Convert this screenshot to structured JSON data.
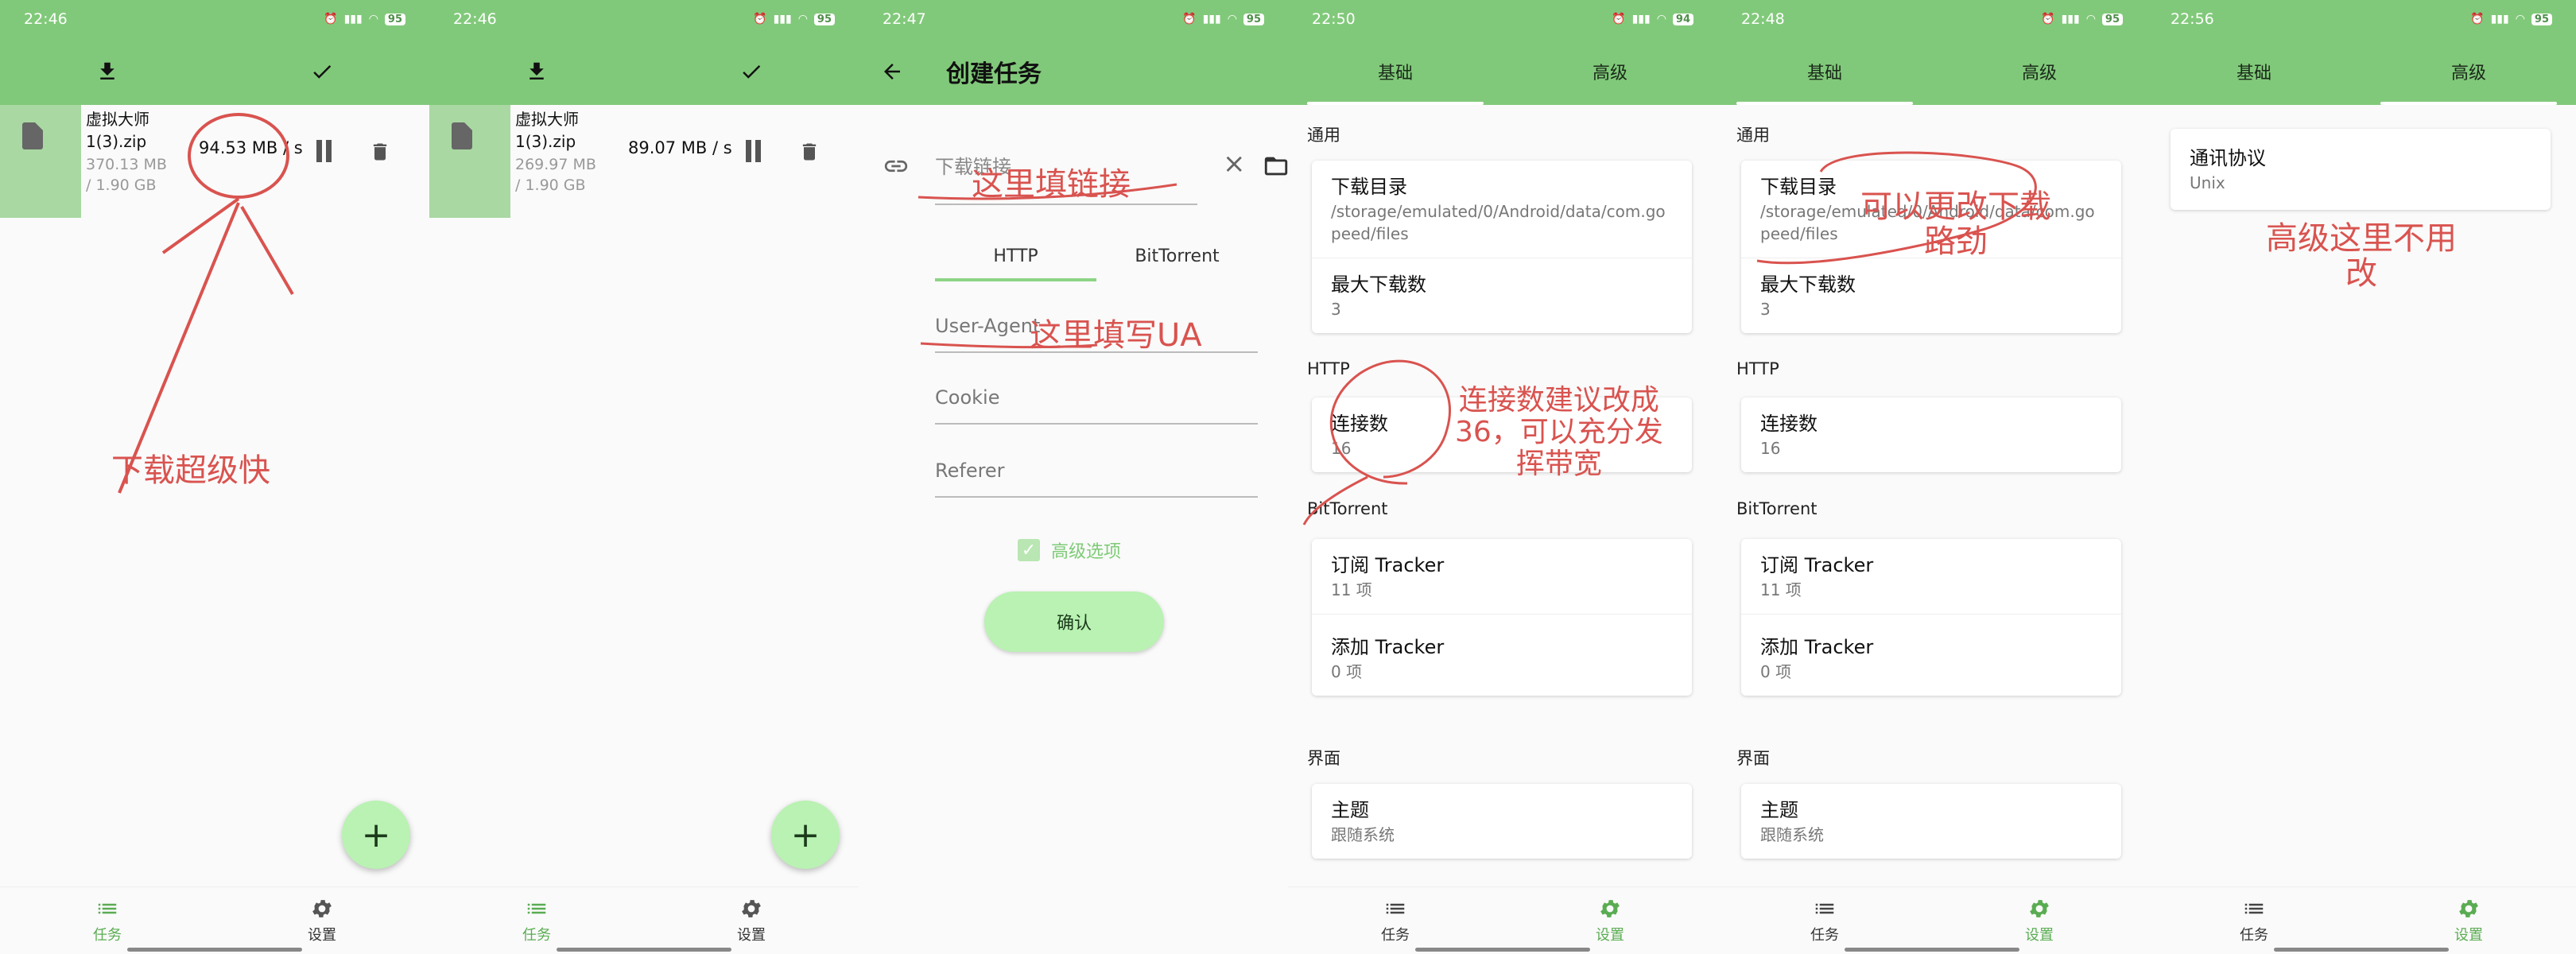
{
  "screens": [
    {
      "status": {
        "time": "22:46",
        "battery": "95"
      },
      "toolbar": {
        "download_icon": "download-icon",
        "check_icon": "check-icon"
      },
      "task": {
        "name": "虚拟大师1(3).zip",
        "size": "370.13 MB / 1.90 GB",
        "speed": "94.53 MB / s"
      },
      "annotation": "下载超级快",
      "nav": {
        "tasks": "任务",
        "settings": "设置"
      }
    },
    {
      "status": {
        "time": "22:46",
        "battery": "95"
      },
      "task": {
        "name": "虚拟大师1(3).zip",
        "size": "269.97 MB / 1.90 GB",
        "speed": "89.07 MB / s"
      },
      "nav": {
        "tasks": "任务",
        "settings": "设置"
      }
    },
    {
      "status": {
        "time": "22:47",
        "battery": "95"
      },
      "title": "创建任务",
      "link_placeholder": "下载链接",
      "tabs": [
        "HTTP",
        "BitTorrent"
      ],
      "fields": [
        "User-Agent",
        "Cookie",
        "Referer"
      ],
      "advanced": "高级选项",
      "confirm": "确认",
      "annotations": {
        "link": "这里填链接",
        "ua": "这里填写UA"
      }
    },
    {
      "status": {
        "time": "22:50",
        "battery": "94"
      },
      "tabs": [
        "基础",
        "高级"
      ],
      "sections": {
        "general": "通用",
        "http": "HTTP",
        "bt": "BitTorrent",
        "ui": "界面"
      },
      "download_dir": {
        "label": "下载目录",
        "value": "/storage/emulated/0/Android/data/com.gopeed/files"
      },
      "max_downloads": {
        "label": "最大下载数",
        "value": "3"
      },
      "connections": {
        "label": "连接数",
        "value": "16"
      },
      "sub_tracker": {
        "label": "订阅 Tracker",
        "value": "11 项"
      },
      "add_tracker": {
        "label": "添加 Tracker",
        "value": "0 项"
      },
      "theme": {
        "label": "主题",
        "value": "跟随系统"
      },
      "annotation": "连接数建议改成36，可以充分发挥带宽",
      "annotation_lines": [
        "连接数建议改成",
        "36，可以充分发",
        "挥带宽"
      ],
      "nav": {
        "tasks": "任务",
        "settings": "设置"
      }
    },
    {
      "status": {
        "time": "22:48",
        "battery": "95"
      },
      "annotation": "可以更改下载路劲",
      "annotation_lines": [
        "可以更改下载",
        "路劲"
      ]
    },
    {
      "status": {
        "time": "22:56",
        "battery": "95"
      },
      "protocol": {
        "label": "通讯协议",
        "value": "Unix"
      },
      "annotation": "高级这里不用改",
      "annotation_lines": [
        "高级这里不用",
        "改"
      ]
    }
  ],
  "colors": {
    "appbar": "#81c97a",
    "accent": "#5aac52",
    "fab": "#b9f2b2",
    "annotation": "#d9534f"
  }
}
